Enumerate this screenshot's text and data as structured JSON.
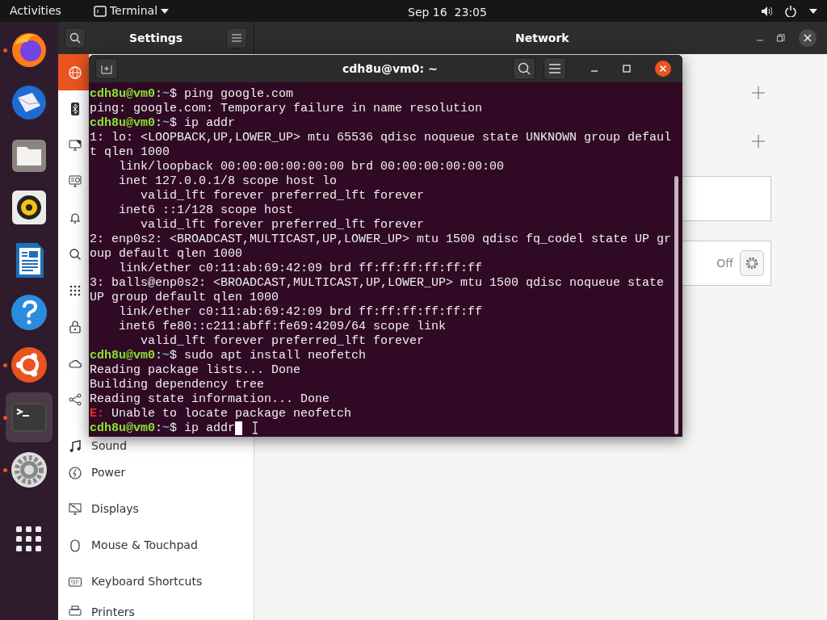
{
  "top_bar": {
    "activities": "Activities",
    "app_menu": "Terminal",
    "clock": "Sep 16  23:05"
  },
  "dock": [
    {
      "kind": "browser",
      "running": true,
      "selected": false
    },
    {
      "kind": "mail",
      "running": false,
      "selected": false
    },
    {
      "kind": "files",
      "running": false,
      "selected": false
    },
    {
      "kind": "music",
      "running": false,
      "selected": false
    },
    {
      "kind": "document",
      "running": false,
      "selected": false
    },
    {
      "kind": "help",
      "running": false,
      "selected": false
    },
    {
      "kind": "software",
      "running": true,
      "selected": false
    },
    {
      "kind": "terminal",
      "running": true,
      "selected": true
    },
    {
      "kind": "settings",
      "running": true,
      "selected": false
    },
    {
      "kind": "apps",
      "running": false,
      "selected": false
    }
  ],
  "settings_window": {
    "title": "Settings",
    "page_title": "Network",
    "sidebar": [
      {
        "kind": "network",
        "selected": true
      },
      {
        "kind": "bluetooth",
        "selected": false
      },
      {
        "kind": "background",
        "selected": false
      },
      {
        "kind": "appearance",
        "selected": false
      },
      {
        "kind": "notifications",
        "selected": false
      },
      {
        "kind": "search",
        "selected": false
      },
      {
        "kind": "applications",
        "selected": false
      },
      {
        "kind": "privacy",
        "selected": false
      },
      {
        "kind": "online",
        "selected": false
      },
      {
        "kind": "sharing",
        "selected": false
      },
      {
        "kind": "sound",
        "label": "Sound",
        "selected": false
      },
      {
        "kind": "power",
        "label": "Power",
        "selected": false
      },
      {
        "kind": "displays",
        "label": "Displays",
        "selected": false
      },
      {
        "kind": "mouse",
        "label": "Mouse & Touchpad",
        "selected": false
      },
      {
        "kind": "keyboard",
        "label": "Keyboard Shortcuts",
        "selected": false
      },
      {
        "kind": "printers",
        "label": "Printers",
        "selected": false
      }
    ],
    "panels": [
      {
        "kind": "add"
      },
      {
        "kind": "add"
      },
      {
        "kind": "blank"
      },
      {
        "kind": "toggle",
        "status": "Off"
      }
    ]
  },
  "terminal": {
    "title": "cdh8u@vm0: ~",
    "lines": [
      {
        "kind": "prompt",
        "user_host": "cdh8u@vm0",
        "colon": ":",
        "path": "~",
        "command": "$ ping google.com"
      },
      {
        "kind": "output",
        "text": "ping: google.com: Temporary failure in name resolution"
      },
      {
        "kind": "prompt",
        "user_host": "cdh8u@vm0",
        "colon": ":",
        "path": "~",
        "command": "$ ip addr"
      },
      {
        "kind": "output",
        "text": "1: lo: <LOOPBACK,UP,LOWER_UP> mtu 65536 qdisc noqueue state UNKNOWN group defaul"
      },
      {
        "kind": "output",
        "text": "t qlen 1000"
      },
      {
        "kind": "output",
        "text": "    link/loopback 00:00:00:00:00:00 brd 00:00:00:00:00:00"
      },
      {
        "kind": "output",
        "text": "    inet 127.0.0.1/8 scope host lo"
      },
      {
        "kind": "output",
        "text": "       valid_lft forever preferred_lft forever"
      },
      {
        "kind": "output",
        "text": "    inet6 ::1/128 scope host"
      },
      {
        "kind": "output",
        "text": "       valid_lft forever preferred_lft forever"
      },
      {
        "kind": "output",
        "text": "2: enp0s2: <BROADCAST,MULTICAST,UP,LOWER_UP> mtu 1500 qdisc fq_codel state UP gr"
      },
      {
        "kind": "output",
        "text": "oup default qlen 1000"
      },
      {
        "kind": "output",
        "text": "    link/ether c0:11:ab:69:42:09 brd ff:ff:ff:ff:ff:ff"
      },
      {
        "kind": "output",
        "text": "3: balls@enp0s2: <BROADCAST,MULTICAST,UP,LOWER_UP> mtu 1500 qdisc noqueue state"
      },
      {
        "kind": "output",
        "text": "UP group default qlen 1000"
      },
      {
        "kind": "output",
        "text": "    link/ether c0:11:ab:69:42:09 brd ff:ff:ff:ff:ff:ff"
      },
      {
        "kind": "output",
        "text": "    inet6 fe80::c211:abff:fe69:4209/64 scope link"
      },
      {
        "kind": "output",
        "text": "       valid_lft forever preferred_lft forever"
      },
      {
        "kind": "prompt",
        "user_host": "cdh8u@vm0",
        "colon": ":",
        "path": "~",
        "command": "$ sudo apt install neofetch"
      },
      {
        "kind": "output",
        "text": "Reading package lists... Done"
      },
      {
        "kind": "output",
        "text": "Building dependency tree"
      },
      {
        "kind": "output",
        "text": "Reading state information... Done"
      },
      {
        "kind": "error",
        "prefix": "E:",
        "text": " Unable to locate package neofetch"
      },
      {
        "kind": "prompt",
        "user_host": "cdh8u@vm0",
        "colon": ":",
        "path": "~",
        "command": "$ ip addr",
        "cursor": true
      }
    ]
  }
}
